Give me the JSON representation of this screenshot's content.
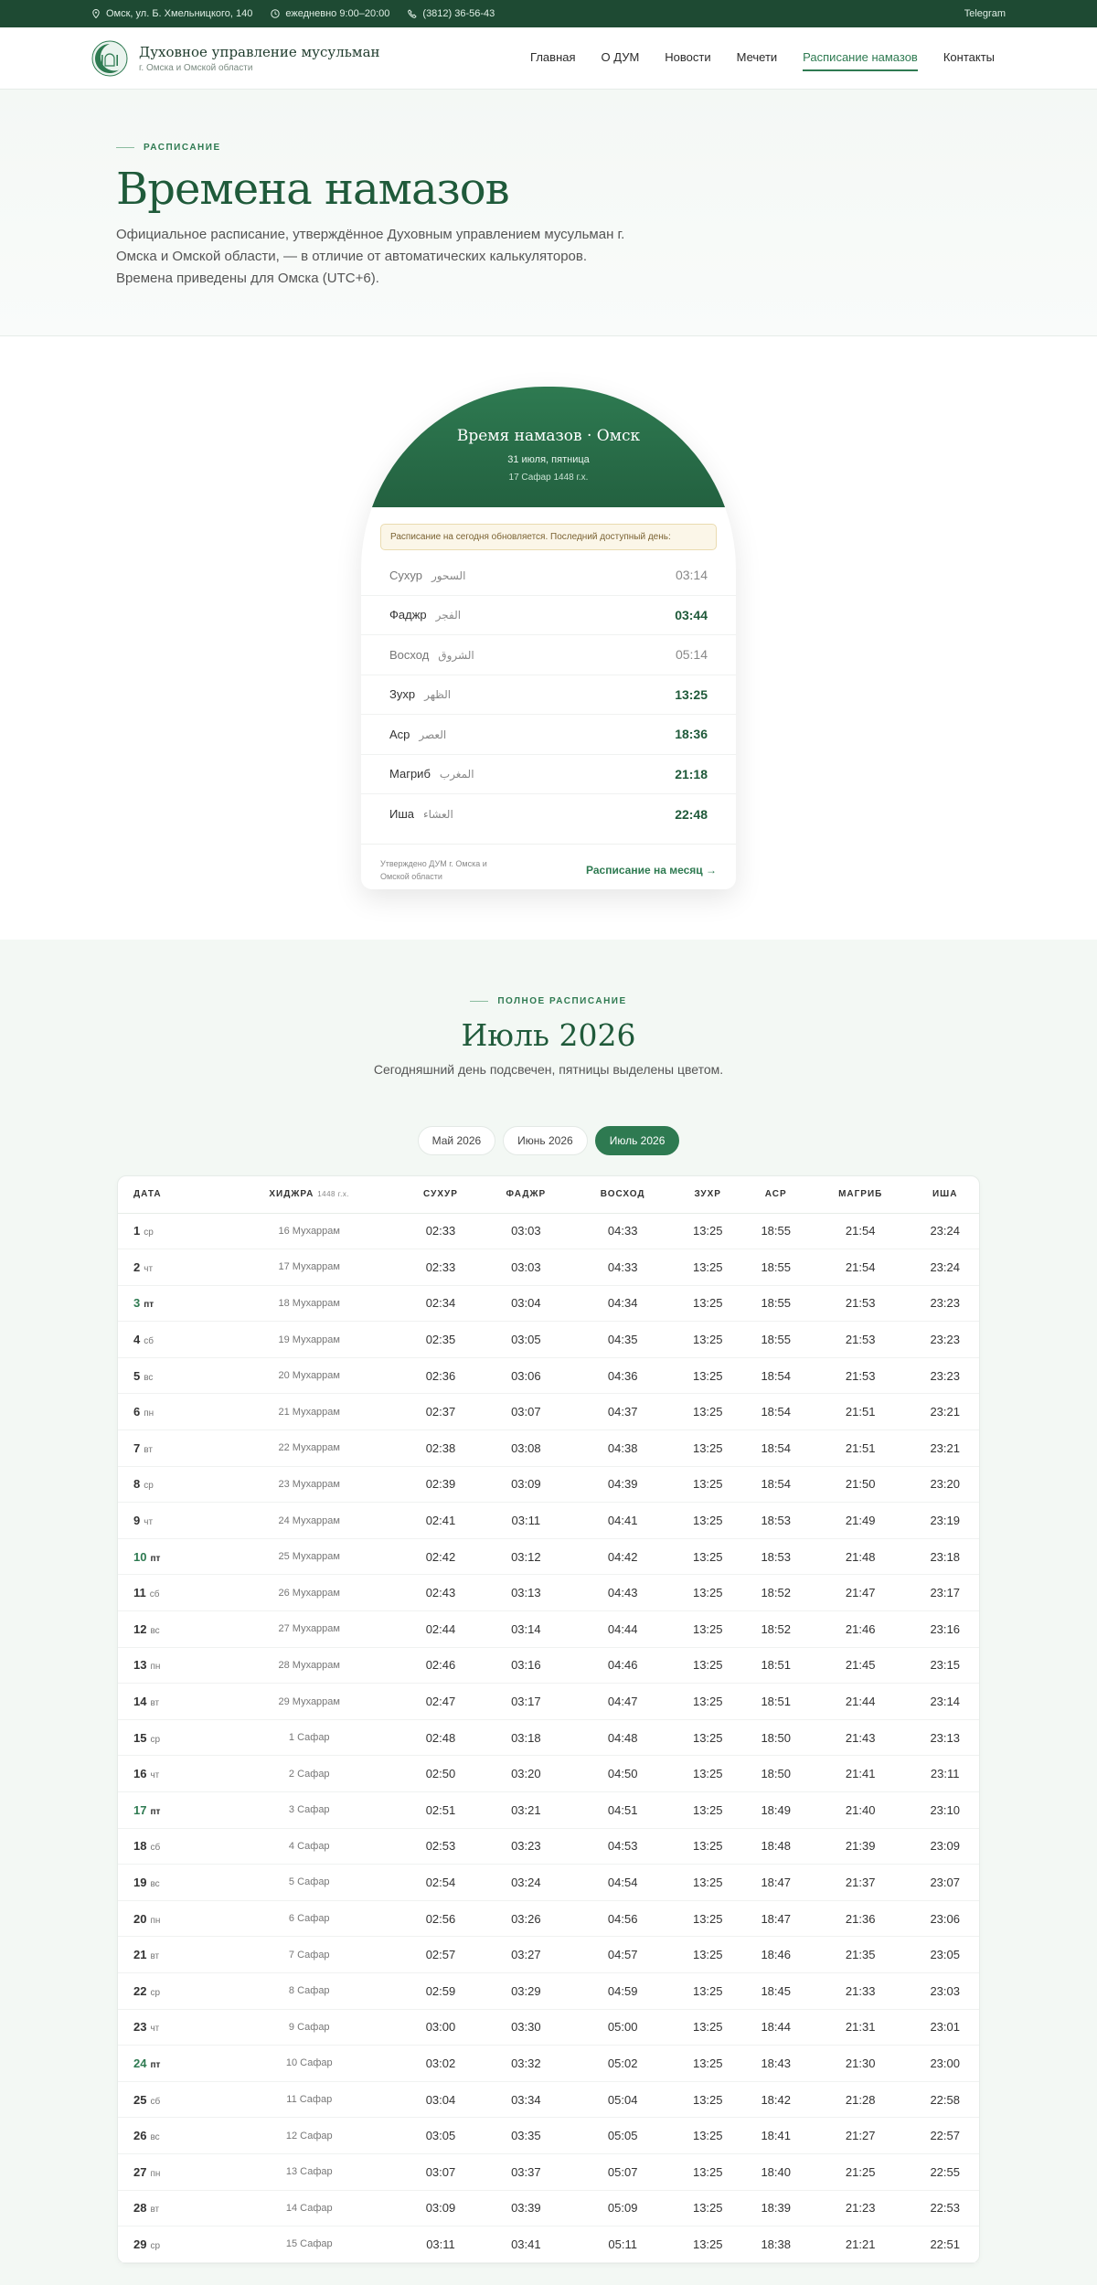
{
  "topbar": {
    "address": "Омск, ул. Б. Хмельницкого, 140",
    "hours": "ежедневно 9:00–20:00",
    "phone": "(3812) 36-56-43",
    "telegram": "Telegram"
  },
  "brand": {
    "title": "Духовное управление мусульман",
    "subtitle": "г. Омска и Омской области"
  },
  "nav": [
    "Главная",
    "О ДУМ",
    "Новости",
    "Мечети",
    "Расписание намазов",
    "Контакты"
  ],
  "nav_active": "Расписание намазов",
  "hero": {
    "eyebrow": "РАСПИСАНИЕ",
    "title": "Времена намазов",
    "text": "Официальное расписание, утверждённое Духовным управлением мусульман г. Омска и Омской области, — в отличие от автоматических калькуляторов. Времена приведены для Омска (UTC+6)."
  },
  "today": {
    "title": "Время намазов · Омск",
    "date": "31 июля, пятница",
    "hijri": "17 Сафар 1448 г.х.",
    "notice": "Расписание на сегодня обновляется. Последний доступный день:",
    "prayers": [
      {
        "name": "Сухур",
        "arabic": "السحور",
        "time": "03:14",
        "main": false
      },
      {
        "name": "Фаджр",
        "arabic": "الفجر",
        "time": "03:44",
        "main": true
      },
      {
        "name": "Восход",
        "arabic": "الشروق",
        "time": "05:14",
        "main": false
      },
      {
        "name": "Зухр",
        "arabic": "الظهر",
        "time": "13:25",
        "main": true
      },
      {
        "name": "Аср",
        "arabic": "العصر",
        "time": "18:36",
        "main": true
      },
      {
        "name": "Магриб",
        "arabic": "المغرب",
        "time": "21:18",
        "main": true
      },
      {
        "name": "Иша",
        "arabic": "العشاء",
        "time": "22:48",
        "main": true
      }
    ],
    "approved": "Утверждено ДУМ г. Омска и Омской области",
    "month_link": "Расписание на месяц →"
  },
  "full": {
    "eyebrow": "ПОЛНОЕ РАСПИСАНИЕ",
    "title": "Июль 2026",
    "subtitle": "Сегодняшний день подсвечен, пятницы выделены цветом.",
    "tabs": [
      "Май 2026",
      "Июнь 2026",
      "Июль 2026"
    ],
    "active_tab": "Июль 2026",
    "columns": {
      "date": "ДАТА",
      "hijri": "ХИДЖРА",
      "hijri_year": "1448 г.х.",
      "suhur": "СУХУР",
      "fajr": "ФАДЖР",
      "sunrise": "ВОСХОД",
      "zuhr": "ЗУХР",
      "asr": "АСР",
      "maghrib": "МАГРИБ",
      "isha": "ИША"
    },
    "rows": [
      [
        "1",
        "ср",
        "16 Мухаррам",
        "02:33",
        "03:03",
        "04:33",
        "13:25",
        "18:55",
        "21:54",
        "23:24"
      ],
      [
        "2",
        "чт",
        "17 Мухаррам",
        "02:33",
        "03:03",
        "04:33",
        "13:25",
        "18:55",
        "21:54",
        "23:24"
      ],
      [
        "3",
        "пт",
        "18 Мухаррам",
        "02:34",
        "03:04",
        "04:34",
        "13:25",
        "18:55",
        "21:53",
        "23:23"
      ],
      [
        "4",
        "сб",
        "19 Мухаррам",
        "02:35",
        "03:05",
        "04:35",
        "13:25",
        "18:55",
        "21:53",
        "23:23"
      ],
      [
        "5",
        "вс",
        "20 Мухаррам",
        "02:36",
        "03:06",
        "04:36",
        "13:25",
        "18:54",
        "21:53",
        "23:23"
      ],
      [
        "6",
        "пн",
        "21 Мухаррам",
        "02:37",
        "03:07",
        "04:37",
        "13:25",
        "18:54",
        "21:51",
        "23:21"
      ],
      [
        "7",
        "вт",
        "22 Мухаррам",
        "02:38",
        "03:08",
        "04:38",
        "13:25",
        "18:54",
        "21:51",
        "23:21"
      ],
      [
        "8",
        "ср",
        "23 Мухаррам",
        "02:39",
        "03:09",
        "04:39",
        "13:25",
        "18:54",
        "21:50",
        "23:20"
      ],
      [
        "9",
        "чт",
        "24 Мухаррам",
        "02:41",
        "03:11",
        "04:41",
        "13:25",
        "18:53",
        "21:49",
        "23:19"
      ],
      [
        "10",
        "пт",
        "25 Мухаррам",
        "02:42",
        "03:12",
        "04:42",
        "13:25",
        "18:53",
        "21:48",
        "23:18"
      ],
      [
        "11",
        "сб",
        "26 Мухаррам",
        "02:43",
        "03:13",
        "04:43",
        "13:25",
        "18:52",
        "21:47",
        "23:17"
      ],
      [
        "12",
        "вс",
        "27 Мухаррам",
        "02:44",
        "03:14",
        "04:44",
        "13:25",
        "18:52",
        "21:46",
        "23:16"
      ],
      [
        "13",
        "пн",
        "28 Мухаррам",
        "02:46",
        "03:16",
        "04:46",
        "13:25",
        "18:51",
        "21:45",
        "23:15"
      ],
      [
        "14",
        "вт",
        "29 Мухаррам",
        "02:47",
        "03:17",
        "04:47",
        "13:25",
        "18:51",
        "21:44",
        "23:14"
      ],
      [
        "15",
        "ср",
        "1 Сафар",
        "02:48",
        "03:18",
        "04:48",
        "13:25",
        "18:50",
        "21:43",
        "23:13"
      ],
      [
        "16",
        "чт",
        "2 Сафар",
        "02:50",
        "03:20",
        "04:50",
        "13:25",
        "18:50",
        "21:41",
        "23:11"
      ],
      [
        "17",
        "пт",
        "3 Сафар",
        "02:51",
        "03:21",
        "04:51",
        "13:25",
        "18:49",
        "21:40",
        "23:10"
      ],
      [
        "18",
        "сб",
        "4 Сафар",
        "02:53",
        "03:23",
        "04:53",
        "13:25",
        "18:48",
        "21:39",
        "23:09"
      ],
      [
        "19",
        "вс",
        "5 Сафар",
        "02:54",
        "03:24",
        "04:54",
        "13:25",
        "18:47",
        "21:37",
        "23:07"
      ],
      [
        "20",
        "пн",
        "6 Сафар",
        "02:56",
        "03:26",
        "04:56",
        "13:25",
        "18:47",
        "21:36",
        "23:06"
      ],
      [
        "21",
        "вт",
        "7 Сафар",
        "02:57",
        "03:27",
        "04:57",
        "13:25",
        "18:46",
        "21:35",
        "23:05"
      ],
      [
        "22",
        "ср",
        "8 Сафар",
        "02:59",
        "03:29",
        "04:59",
        "13:25",
        "18:45",
        "21:33",
        "23:03"
      ],
      [
        "23",
        "чт",
        "9 Сафар",
        "03:00",
        "03:30",
        "05:00",
        "13:25",
        "18:44",
        "21:31",
        "23:01"
      ],
      [
        "24",
        "пт",
        "10 Сафар",
        "03:02",
        "03:32",
        "05:02",
        "13:25",
        "18:43",
        "21:30",
        "23:00"
      ],
      [
        "25",
        "сб",
        "11 Сафар",
        "03:04",
        "03:34",
        "05:04",
        "13:25",
        "18:42",
        "21:28",
        "22:58"
      ],
      [
        "26",
        "вс",
        "12 Сафар",
        "03:05",
        "03:35",
        "05:05",
        "13:25",
        "18:41",
        "21:27",
        "22:57"
      ],
      [
        "27",
        "пн",
        "13 Сафар",
        "03:07",
        "03:37",
        "05:07",
        "13:25",
        "18:40",
        "21:25",
        "22:55"
      ],
      [
        "28",
        "вт",
        "14 Сафар",
        "03:09",
        "03:39",
        "05:09",
        "13:25",
        "18:39",
        "21:23",
        "22:53"
      ],
      [
        "29",
        "ср",
        "15 Сафар",
        "03:11",
        "03:41",
        "05:11",
        "13:25",
        "18:38",
        "21:21",
        "22:51"
      ]
    ]
  },
  "colors": {
    "accent": "#2e7a51",
    "dark_green": "#1e4a33",
    "title_green": "#1f5a3a",
    "notice_bg": "#fbf6e8"
  }
}
